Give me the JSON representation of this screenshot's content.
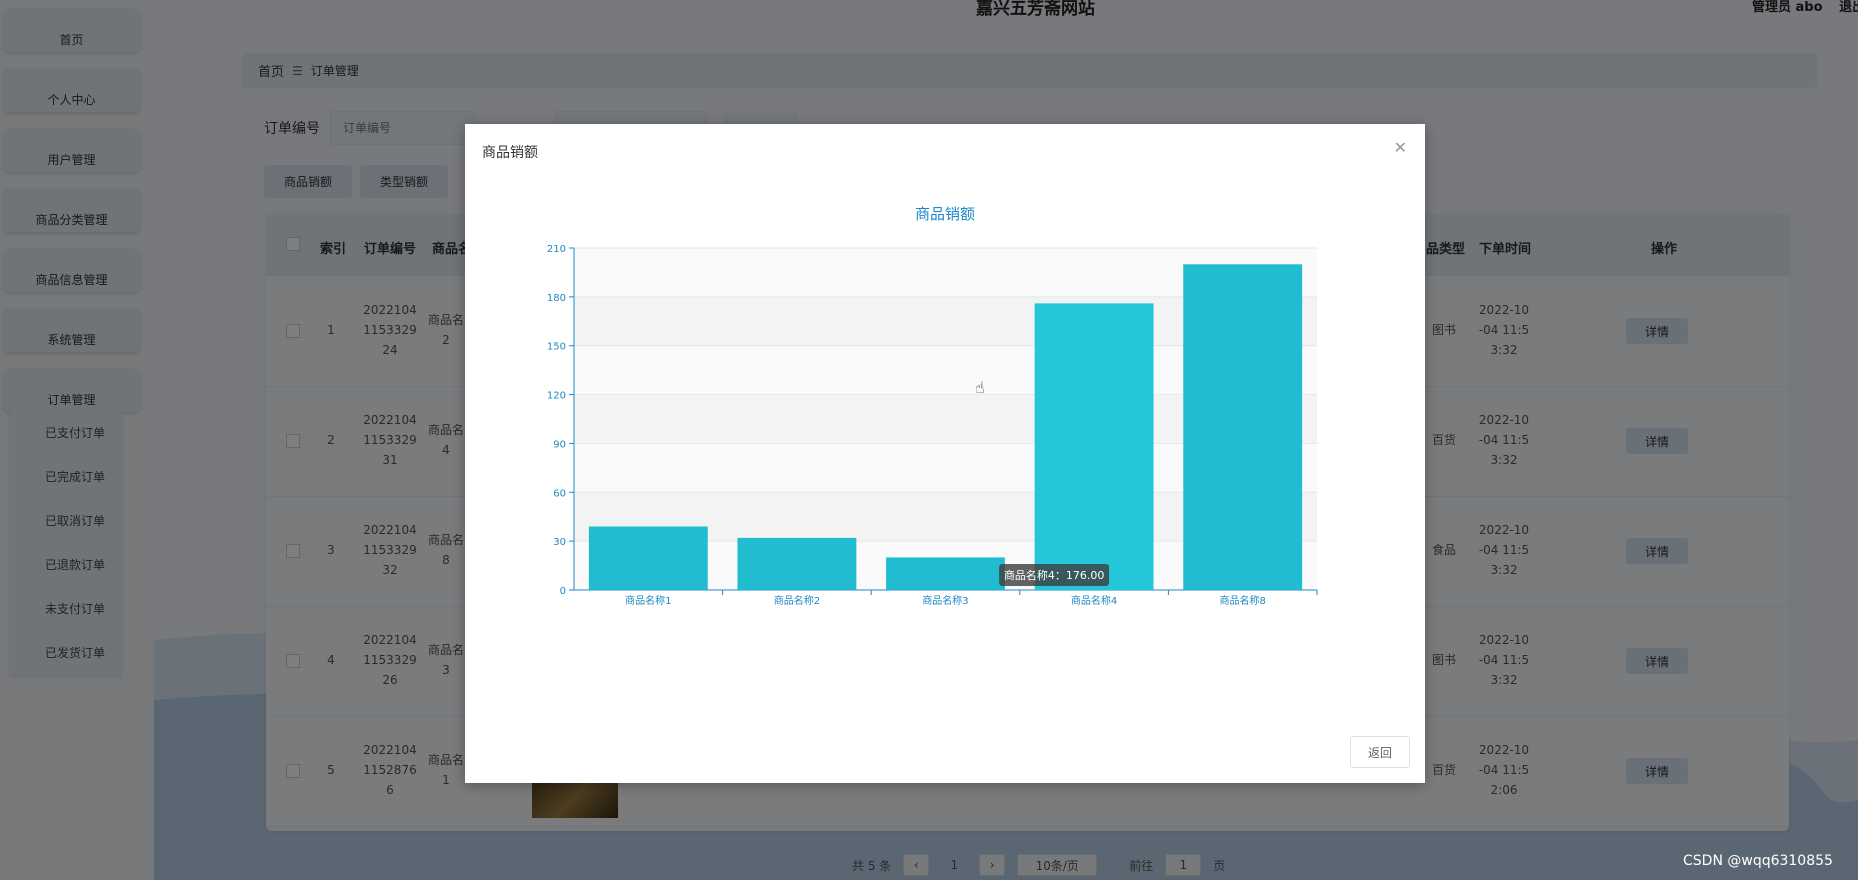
{
  "site_title": "嘉兴五芳斋网站",
  "admin": {
    "label": "管理员 abo",
    "logout": "退出"
  },
  "sidebar": {
    "items": [
      "首页",
      "个人中心",
      "用户管理",
      "商品分类管理",
      "商品信息管理",
      "系统管理",
      "订单管理"
    ],
    "sub_items": [
      "已支付订单",
      "已完成订单",
      "已取消订单",
      "已退款订单",
      "未支付订单",
      "已发货订单"
    ]
  },
  "breadcrumb": {
    "home": "首页",
    "current": "订单管理"
  },
  "search": {
    "label": "订单编号",
    "placeholder": "订单编号"
  },
  "toolbar": {
    "goods_sales": "商品销额",
    "type_sales": "类型销额"
  },
  "table": {
    "headers": {
      "index": "索引",
      "order_no": "订单编号",
      "goods_name": "商品名",
      "goods_type": "品类型",
      "order_time": "下单时间",
      "actions": "操作"
    },
    "detail_label": "详情",
    "rows": [
      {
        "index": "1",
        "order_no": [
          "2022104",
          "1153329",
          "24"
        ],
        "goods": [
          "商品名",
          "2"
        ],
        "type": "图书",
        "time": [
          "2022-10",
          "-04 11:5",
          "3:32"
        ]
      },
      {
        "index": "2",
        "order_no": [
          "2022104",
          "1153329",
          "31"
        ],
        "goods": [
          "商品名",
          "4"
        ],
        "type": "百货",
        "time": [
          "2022-10",
          "-04 11:5",
          "3:32"
        ]
      },
      {
        "index": "3",
        "order_no": [
          "2022104",
          "1153329",
          "32"
        ],
        "goods": [
          "商品名",
          "8"
        ],
        "type": "食品",
        "time": [
          "2022-10",
          "-04 11:5",
          "3:32"
        ]
      },
      {
        "index": "4",
        "order_no": [
          "2022104",
          "1153329",
          "26"
        ],
        "goods": [
          "商品名",
          "3"
        ],
        "type": "图书",
        "time": [
          "2022-10",
          "-04 11:5",
          "3:32"
        ]
      },
      {
        "index": "5",
        "order_no": [
          "2022104",
          "1152876",
          "6"
        ],
        "goods": [
          "商品名",
          "1"
        ],
        "type": "百货",
        "time": [
          "2022-10",
          "-04 11:5",
          "2:06"
        ]
      }
    ]
  },
  "pagination": {
    "total": "共 5 条",
    "page": "1",
    "page_size": "10条/页",
    "goto_label": "前往",
    "goto_value": "1",
    "page_unit": "页"
  },
  "dialog": {
    "title": "商品销额",
    "return_label": "返回",
    "close_icon": "close-icon"
  },
  "chart_data": {
    "type": "bar",
    "title": "商品销额",
    "categories": [
      "商品名称1",
      "商品名称2",
      "商品名称3",
      "商品名称4",
      "商品名称8"
    ],
    "values": [
      39,
      32,
      20,
      176,
      200
    ],
    "ylim": [
      0,
      210
    ],
    "yticks": [
      0,
      30,
      60,
      90,
      120,
      150,
      180,
      210
    ],
    "tooltip": "商品名称4：176.00",
    "bar_color": "#22bcd0",
    "axis_color": "#1e88c8"
  },
  "watermark": "CSDN @wqq6310855"
}
